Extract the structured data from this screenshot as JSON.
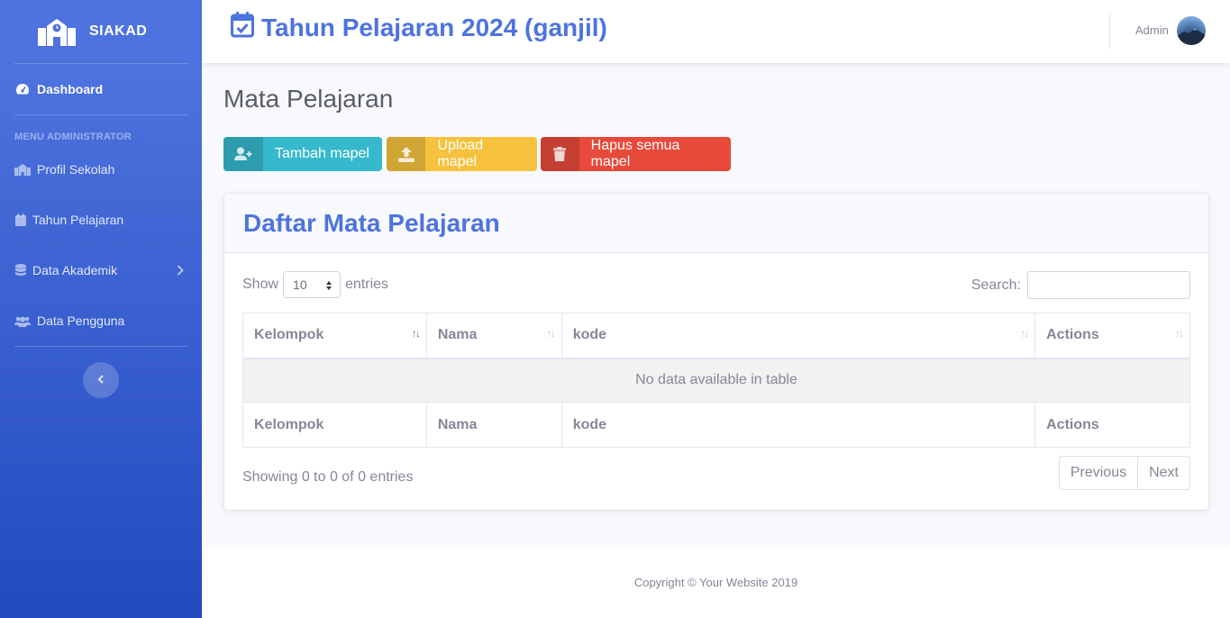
{
  "brand": {
    "name": "SIAKAD",
    "icon": "school-icon"
  },
  "sidebar": {
    "dashboard": {
      "label": "Dashboard",
      "icon": "tachometer-icon"
    },
    "heading": "MENU ADMINISTRATOR",
    "items": [
      {
        "label": "Profil Sekolah",
        "icon": "school-icon"
      },
      {
        "label": "Tahun Pelajaran",
        "icon": "calendar-icon"
      },
      {
        "label": "Data Akademik",
        "icon": "database-icon",
        "has_submenu": true
      },
      {
        "label": "Data Pengguna",
        "icon": "users-icon"
      }
    ],
    "toggle_icon": "chevron-left-icon"
  },
  "topbar": {
    "title": "Tahun Pelajaran 2024 (ganjil)",
    "title_icon": "calendar-check-icon",
    "user_name": "Admin",
    "accent": "#4e73df"
  },
  "page": {
    "title": "Mata Pelajaran",
    "buttons": {
      "add": {
        "label": "Tambah mapel",
        "icon": "user-plus-icon",
        "color": "#36b9cc"
      },
      "upload": {
        "label": "Upload mapel",
        "icon": "upload-icon",
        "color": "#f6c23e"
      },
      "delete_all": {
        "label": "Hapus semua mapel",
        "icon": "trash-icon",
        "color": "#e74a3b"
      }
    }
  },
  "card": {
    "title": "Daftar Mata Pelajaran",
    "length": {
      "show": "Show",
      "value": "10",
      "entries": "entries"
    },
    "search": {
      "label": "Search:",
      "value": ""
    },
    "table": {
      "columns": [
        "Kelompok",
        "Nama",
        "kode",
        "Actions"
      ],
      "empty_message": "No data available in table",
      "rows": []
    },
    "info": "Showing 0 to 0 of 0 entries",
    "pagination": {
      "previous": "Previous",
      "next": "Next"
    }
  },
  "footer": {
    "text": "Copyright © Your Website 2019"
  }
}
